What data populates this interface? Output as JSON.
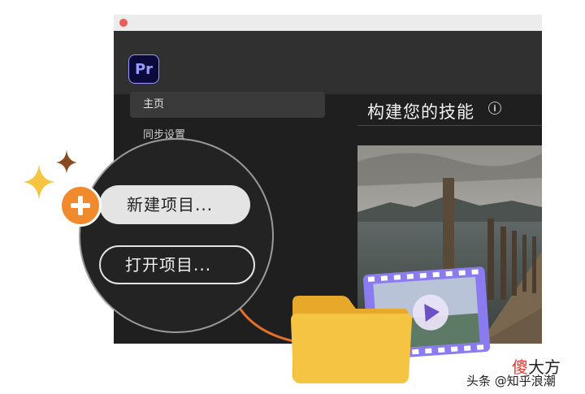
{
  "app": {
    "logo_text": "Pr"
  },
  "sidebar": {
    "items": [
      {
        "label": "主页",
        "selected": true
      },
      {
        "label": "同步设置",
        "selected": false
      }
    ]
  },
  "main": {
    "section_title": "构建您的技能",
    "info_icon": "info-icon"
  },
  "zoom_menu": {
    "new_project_label": "新建项目...",
    "open_project_label": "打开项目..."
  },
  "watermark": {
    "top_accent": "傻",
    "top_rest": "大方",
    "bottom": "头条 @知乎浪潮"
  },
  "colors": {
    "accent_orange": "#f08a2c",
    "sparkle_gold": "#f5c542",
    "sparkle_brown": "#8a4a1f",
    "folder_yellow": "#f6c443",
    "film_purple": "#8a7cf0"
  }
}
